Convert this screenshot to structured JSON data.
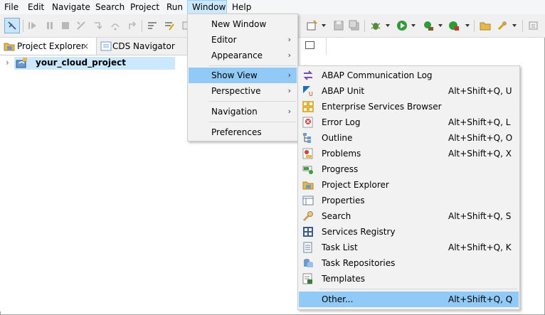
{
  "menubar": {
    "items": [
      "File",
      "Edit",
      "Navigate",
      "Search",
      "Project",
      "Run",
      "Window",
      "Help"
    ],
    "active": "Window"
  },
  "explorer": {
    "tabs": [
      {
        "label": "Project Explorer",
        "icon": "project-explorer-icon",
        "close": "×"
      },
      {
        "label": "CDS Navigator",
        "icon": "cds-navigator-icon"
      }
    ],
    "tree": [
      {
        "label": "your_cloud_project",
        "icon": "cloud-project-icon",
        "selected": true
      }
    ]
  },
  "window_menu": {
    "items": [
      {
        "label": "New Window",
        "submenu": false
      },
      {
        "label": "Editor",
        "submenu": true
      },
      {
        "label": "Appearance",
        "submenu": true
      },
      {
        "label": "Show View",
        "submenu": true,
        "highlighted": true
      },
      {
        "label": "Perspective",
        "submenu": true
      },
      {
        "label": "Navigation",
        "submenu": true
      },
      {
        "label": "Preferences",
        "submenu": false
      }
    ],
    "arrow_glyph": "›"
  },
  "show_view_menu": {
    "items": [
      {
        "label": "ABAP Communication Log",
        "shortcut": "",
        "icon": "communication-log-icon"
      },
      {
        "label": "ABAP Unit",
        "shortcut": "Alt+Shift+Q, U",
        "icon": "abap-unit-icon"
      },
      {
        "label": "Enterprise Services Browser",
        "shortcut": "",
        "icon": "services-browser-icon"
      },
      {
        "label": "Error Log",
        "shortcut": "Alt+Shift+Q, L",
        "icon": "error-log-icon"
      },
      {
        "label": "Outline",
        "shortcut": "Alt+Shift+Q, O",
        "icon": "outline-icon"
      },
      {
        "label": "Problems",
        "shortcut": "Alt+Shift+Q, X",
        "icon": "problems-icon"
      },
      {
        "label": "Progress",
        "shortcut": "",
        "icon": "progress-icon"
      },
      {
        "label": "Project Explorer",
        "shortcut": "",
        "icon": "project-explorer-icon"
      },
      {
        "label": "Properties",
        "shortcut": "",
        "icon": "properties-icon"
      },
      {
        "label": "Search",
        "shortcut": "Alt+Shift+Q, S",
        "icon": "search-icon"
      },
      {
        "label": "Services Registry",
        "shortcut": "",
        "icon": "services-registry-icon"
      },
      {
        "label": "Task List",
        "shortcut": "Alt+Shift+Q, K",
        "icon": "task-list-icon"
      },
      {
        "label": "Task Repositories",
        "shortcut": "",
        "icon": "task-repositories-icon"
      },
      {
        "label": "Templates",
        "shortcut": "",
        "icon": "templates-icon"
      },
      {
        "label": "Other...",
        "shortcut": "Alt+Shift+Q, Q",
        "icon": "",
        "highlighted": true
      }
    ]
  },
  "colors": {
    "highlight": "#91c9f7",
    "menubar_active": "#cce8ff",
    "menu_bg": "#f2f2f2",
    "selection": "#cce8ff"
  }
}
